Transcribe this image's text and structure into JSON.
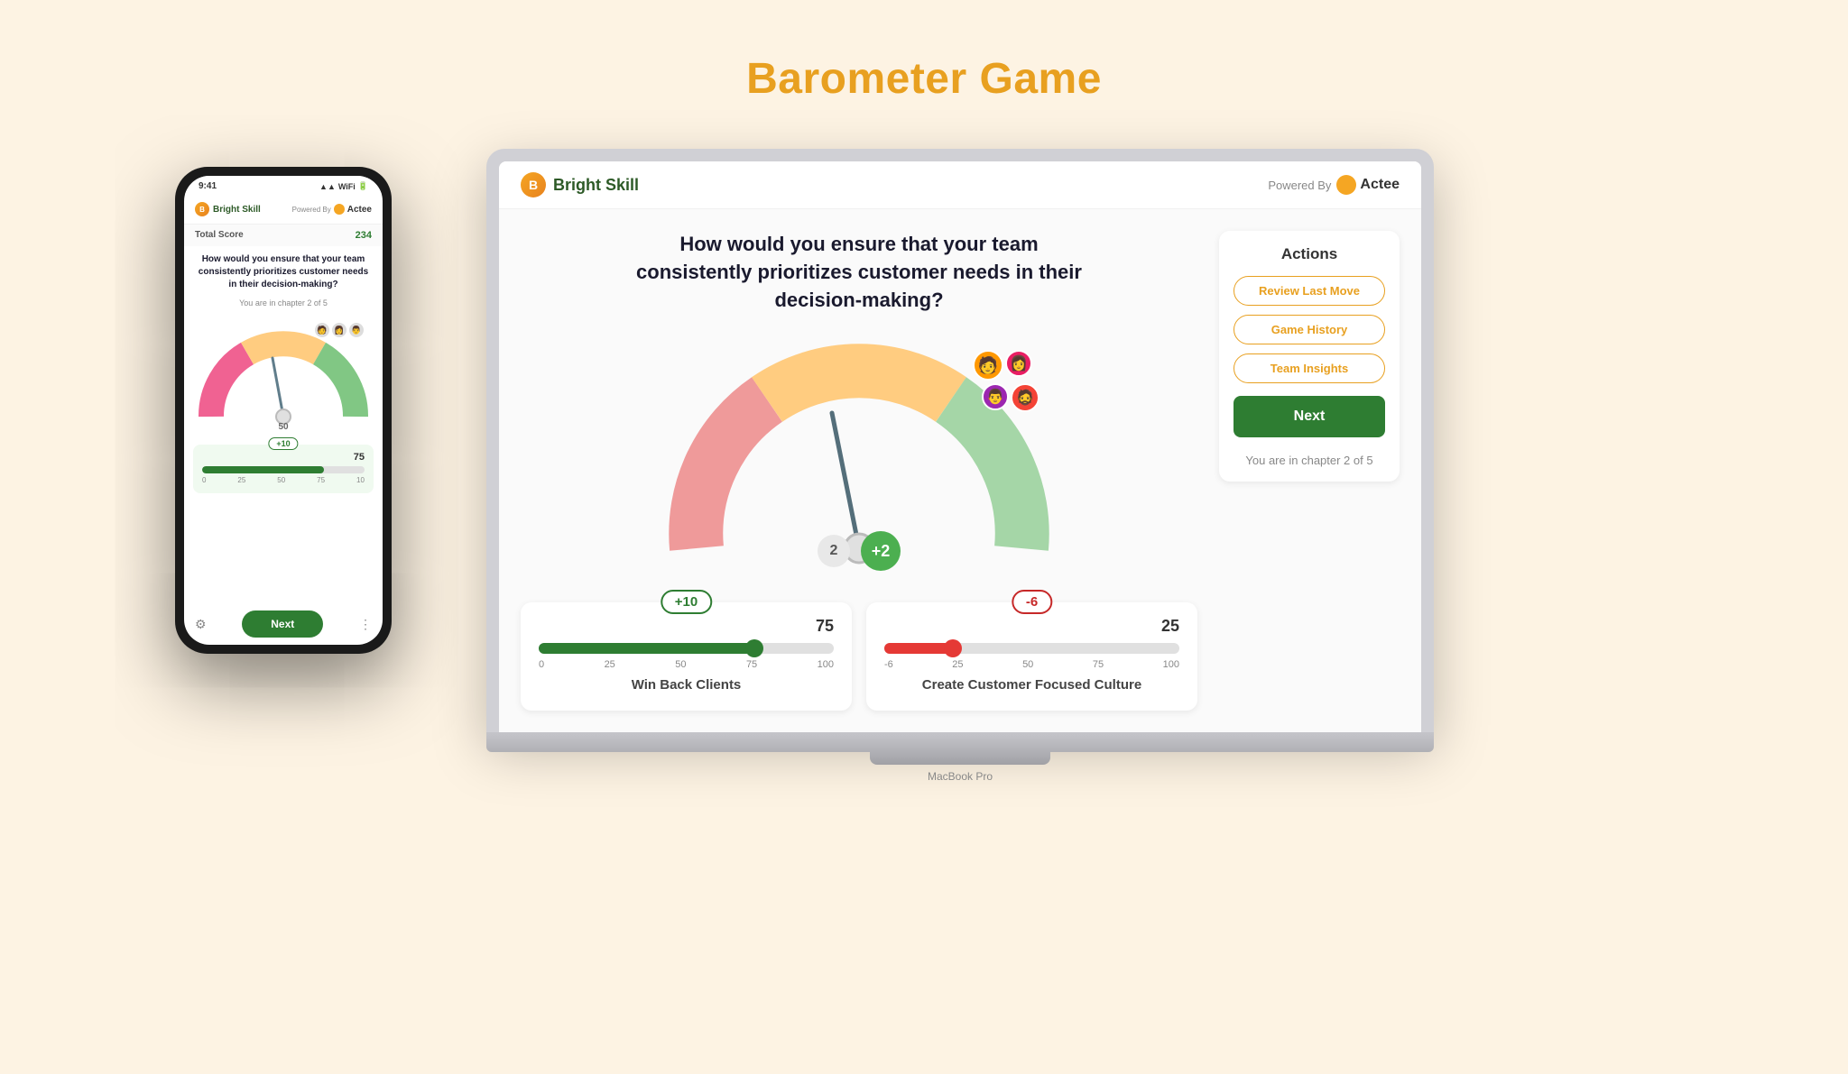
{
  "page": {
    "title": "Barometer Game",
    "background_color": "#fdf3e3"
  },
  "laptop": {
    "label": "MacBook Pro",
    "header": {
      "brand_name": "Bright Skill",
      "powered_by_label": "Powered By",
      "actee_name": "Actee"
    },
    "main": {
      "question": "How would you ensure that your team consistently prioritizes customer needs in their decision-making?",
      "gauge": {
        "needle_value": 2,
        "plus_value": "+2"
      },
      "progress_cards": [
        {
          "badge": "+10",
          "badge_type": "green",
          "value": "75",
          "fill_percent": 75,
          "ticks": [
            "0",
            "25",
            "50",
            "75",
            "100"
          ],
          "label": "Win Back Clients"
        },
        {
          "badge": "-6",
          "badge_type": "red",
          "value": "25",
          "fill_percent": 25,
          "ticks": [
            "-6",
            "25",
            "50",
            "75",
            "100"
          ],
          "label": "Create Customer Focused Culture"
        }
      ]
    },
    "actions": {
      "title": "Actions",
      "buttons": [
        {
          "label": "Review Last Move"
        },
        {
          "label": "Game History"
        },
        {
          "label": "Team Insights"
        }
      ],
      "next_label": "Next",
      "chapter_info": "You are in chapter 2 of 5"
    }
  },
  "phone": {
    "status_bar": {
      "time": "9:41",
      "icons": "▲▲ WiFi Batt"
    },
    "header": {
      "brand_name": "Bright Skill",
      "powered_by_label": "Powered By",
      "actee_name": "Actee"
    },
    "score": {
      "label": "Total Score",
      "value": "234"
    },
    "question": "How would you ensure that your team consistently prioritizes customer needs in their decision-making?",
    "chapter_info": "You are in chapter 2 of 5",
    "gauge": {
      "needle_value": "50"
    },
    "progress_card": {
      "badge": "+10",
      "value": "75",
      "fill_percent": 75,
      "ticks": [
        "0",
        "25",
        "50",
        "75",
        "10"
      ]
    },
    "next_label": "Next"
  },
  "avatars": [
    "👤",
    "👤",
    "👤",
    "👤",
    "👤"
  ]
}
